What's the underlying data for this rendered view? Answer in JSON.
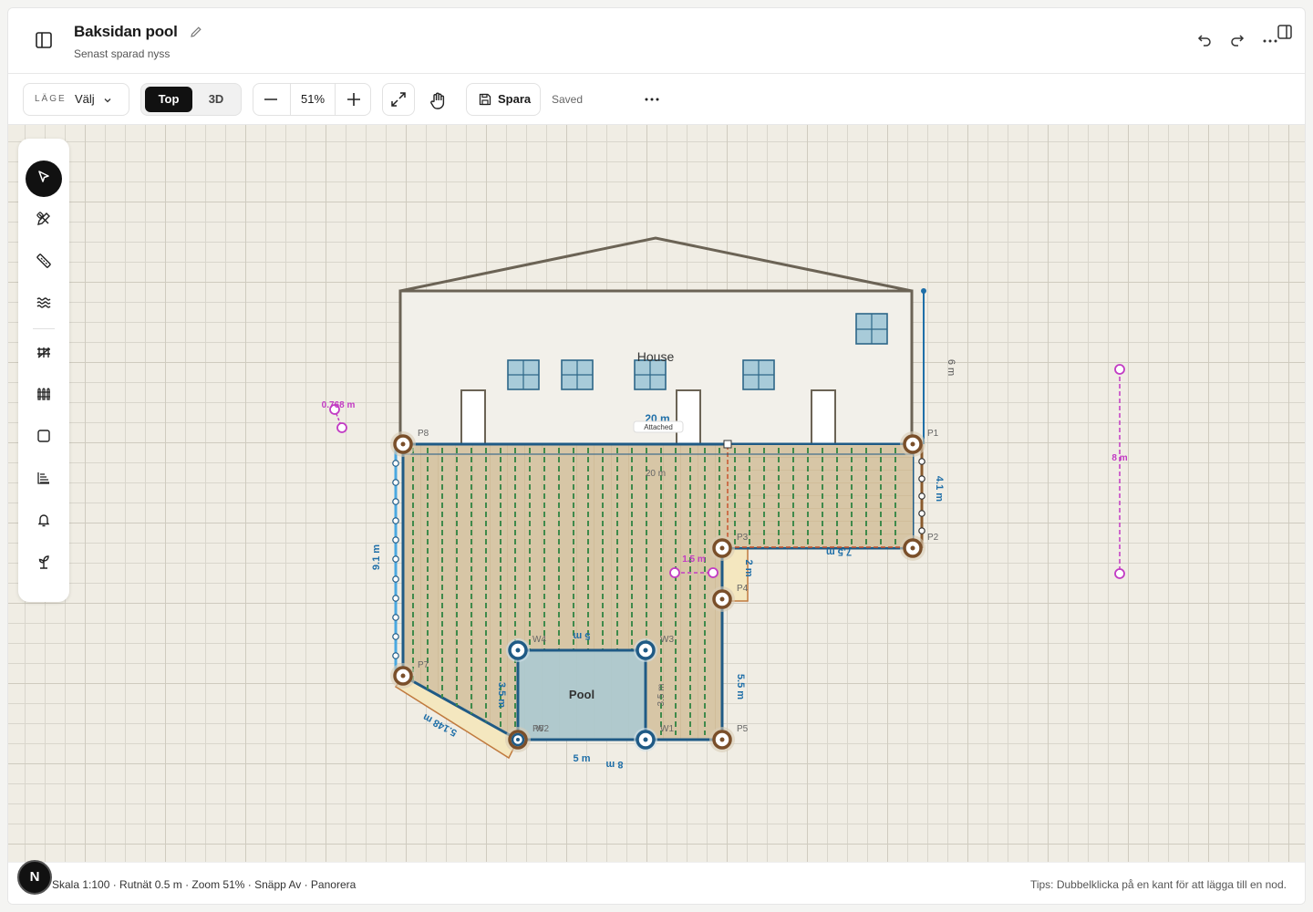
{
  "header": {
    "title": "Baksidan pool",
    "subtitle": "Senast sparad nyss"
  },
  "toolbar": {
    "mode_label": "LÄGE",
    "mode_value": "Välj",
    "view_top": "Top",
    "view_3d": "3D",
    "zoom": "51%",
    "save_label": "Spara",
    "saved_status": "Saved"
  },
  "tools": [
    {
      "name": "select-tool",
      "icon": "cursor-icon",
      "active": true
    },
    {
      "name": "edit-nodes-tool",
      "icon": "pen-ruler-icon"
    },
    {
      "name": "measure-tool",
      "icon": "ruler-icon"
    },
    {
      "name": "water-tool",
      "icon": "waves-icon"
    },
    {
      "name": "railing-tool",
      "icon": "railing-icon"
    },
    {
      "name": "fence-tool",
      "icon": "fence-icon"
    },
    {
      "name": "rectangle-tool",
      "icon": "square-icon"
    },
    {
      "name": "stairs-tool",
      "icon": "stairs-icon"
    },
    {
      "name": "lamp-tool",
      "icon": "bell-lamp-icon"
    },
    {
      "name": "plant-tool",
      "icon": "sprout-icon"
    }
  ],
  "canvas": {
    "house_label": "House",
    "house_width": "20 m",
    "attached_badge": "Attached",
    "house_height": "6 m",
    "deck_width_inner": "20 m",
    "pool_label": "Pool",
    "points": [
      "P1",
      "P2",
      "P3",
      "P4",
      "P5",
      "P6",
      "P7",
      "P8"
    ],
    "pool_points": [
      "W1",
      "W2",
      "W3",
      "W4"
    ],
    "dim_left": "9.1 m",
    "dim_right_top": "4.1 m",
    "dim_step": "2 m",
    "dim_right_low": "5.5 m",
    "dim_bottom_deck": "8 m",
    "dim_diag": "5.148 m",
    "dim_p3_p2": "7.5 m",
    "pool_top": "5 m",
    "pool_bottom": "5 m",
    "pool_left": "3.5 m",
    "pool_right": "3.5 m",
    "measure_small": "0.768 m",
    "measure_mid": "1.5 m",
    "measure_right": "8 m"
  },
  "status": {
    "left": "Skala 1:100 · Rutnät 0.5 m · Zoom 51% · Snäpp Av · Panorera",
    "right": "Tips: Dubbelklicka på en kant för att lägga till en nod."
  },
  "badge": "N",
  "colors": {
    "deck_fill": "#d6c4a3",
    "deck_stroke": "#1f5a85",
    "node_brown": "#7a4f2a",
    "pool_fill": "#a9c9d4",
    "dim_blue": "#1f6fa8",
    "measure_magenta": "#c23bc4",
    "house_stroke": "#6b6355"
  }
}
